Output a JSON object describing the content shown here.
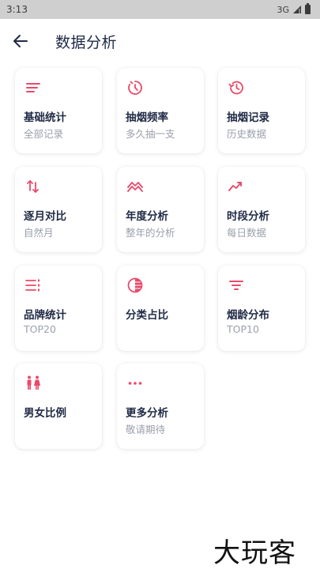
{
  "status": {
    "time": "3:13",
    "network": "3G"
  },
  "header": {
    "title": "数据分析"
  },
  "accent": "#e94a6a",
  "cards": [
    {
      "title": "基础统计",
      "subtitle": "全部记录",
      "icon": "lines-icon"
    },
    {
      "title": "抽烟频率",
      "subtitle": "多久抽一支",
      "icon": "timer-icon"
    },
    {
      "title": "抽烟记录",
      "subtitle": "历史数据",
      "icon": "history-icon"
    },
    {
      "title": "逐月对比",
      "subtitle": "自然月",
      "icon": "swap-vertical-icon"
    },
    {
      "title": "年度分析",
      "subtitle": "整年的分析",
      "icon": "zigzag-icon"
    },
    {
      "title": "时段分析",
      "subtitle": "每日数据",
      "icon": "trending-up-icon"
    },
    {
      "title": "品牌统计",
      "subtitle": "TOP20",
      "icon": "ranked-list-icon"
    },
    {
      "title": "分类占比",
      "subtitle": "",
      "icon": "contrast-circle-icon"
    },
    {
      "title": "烟龄分布",
      "subtitle": "TOP10",
      "icon": "filter-icon"
    },
    {
      "title": "男女比例",
      "subtitle": "",
      "icon": "male-female-icon"
    },
    {
      "title": "更多分析",
      "subtitle": "敬请期待",
      "icon": "more-dots-icon"
    }
  ],
  "watermark": "大玩客"
}
